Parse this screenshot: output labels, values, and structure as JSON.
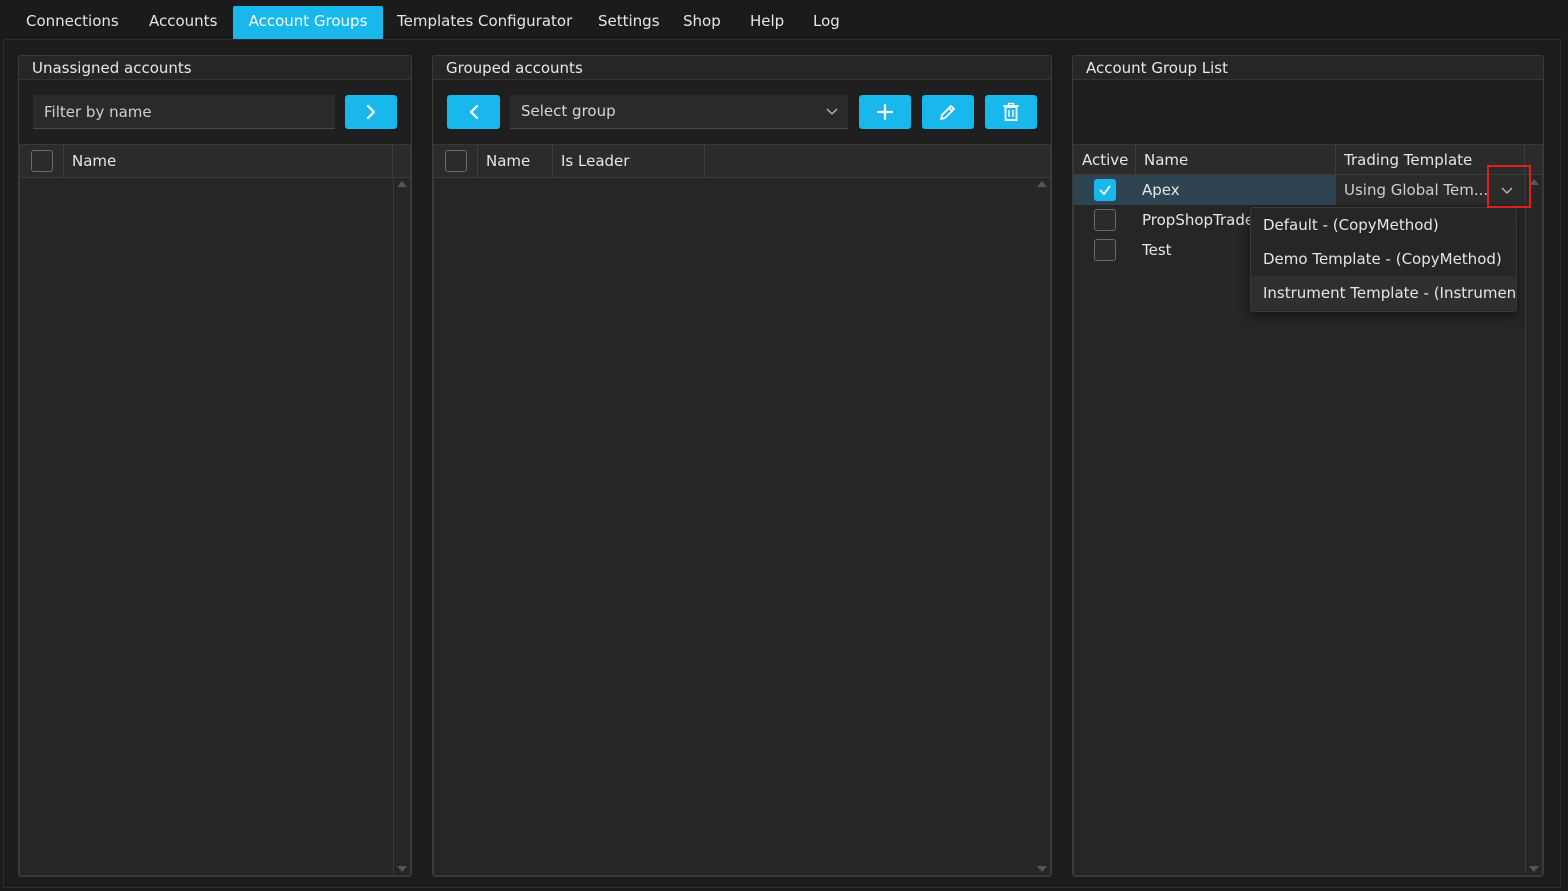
{
  "tabs": [
    {
      "label": "Connections"
    },
    {
      "label": "Accounts"
    },
    {
      "label": "Account Groups"
    },
    {
      "label": "Templates Configurator"
    },
    {
      "label": "Settings"
    },
    {
      "label": "Shop"
    },
    {
      "label": "Help"
    },
    {
      "label": "Log"
    }
  ],
  "active_tab": "Account Groups",
  "unassigned": {
    "title": "Unassigned accounts",
    "filter_placeholder": "Filter by name",
    "columns": [
      "Name"
    ]
  },
  "grouped": {
    "title": "Grouped accounts",
    "select_placeholder": "Select group",
    "columns": [
      "Name",
      "Is Leader"
    ]
  },
  "group_list": {
    "title": "Account Group List",
    "columns": [
      "Active",
      "Name",
      "Trading Template"
    ],
    "rows": [
      {
        "active": true,
        "name": "Apex",
        "template": "Using Global Tem..."
      },
      {
        "active": false,
        "name": "PropShopTrade",
        "template": ""
      },
      {
        "active": false,
        "name": "Test",
        "template": ""
      }
    ]
  },
  "template_dropdown": {
    "options": [
      "Default - (CopyMethod)",
      "Demo Template - (CopyMethod)",
      "Instrument Template - (Instrument)"
    ]
  },
  "colors": {
    "accent": "#19b8ec",
    "highlight": "#e01e1e",
    "background": "#1b1b1b"
  }
}
